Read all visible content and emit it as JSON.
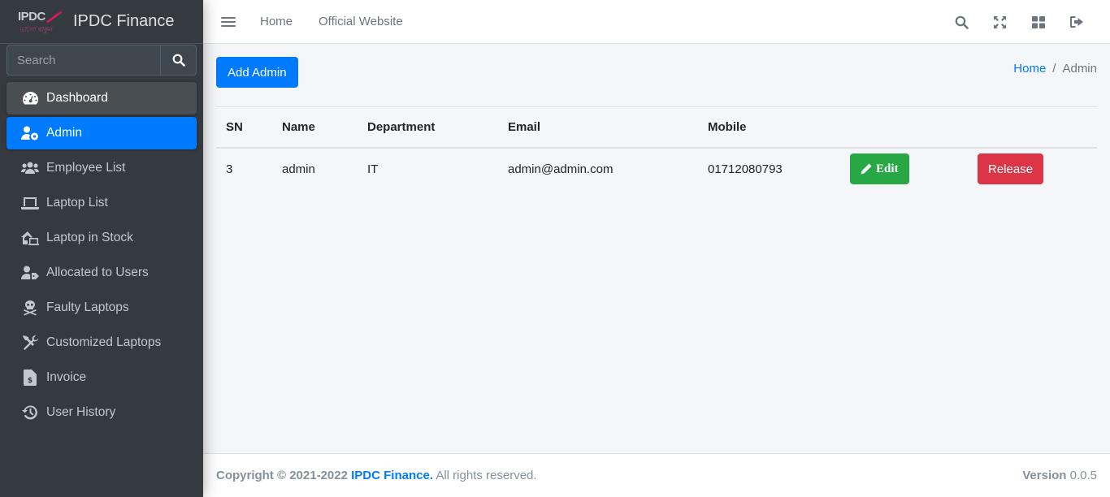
{
  "brand": {
    "name": "IPDC Finance",
    "logo_text": "IPDC",
    "logo_sub": "ভালো থাকুন"
  },
  "search": {
    "placeholder": "Search"
  },
  "sidebar": {
    "items": [
      {
        "label": "Dashboard",
        "icon": "tachometer-icon"
      },
      {
        "label": "Admin",
        "icon": "user-cog-icon"
      },
      {
        "label": "Employee List",
        "icon": "users-icon"
      },
      {
        "label": "Laptop List",
        "icon": "laptop-icon"
      },
      {
        "label": "Laptop in Stock",
        "icon": "laptop-house-icon"
      },
      {
        "label": "Allocated to Users",
        "icon": "user-tag-icon"
      },
      {
        "label": "Faulty Laptops",
        "icon": "skull-crossbones-icon"
      },
      {
        "label": "Customized Laptops",
        "icon": "tools-icon"
      },
      {
        "label": "Invoice",
        "icon": "file-invoice-icon"
      },
      {
        "label": "User History",
        "icon": "history-icon"
      }
    ]
  },
  "topbar": {
    "links": [
      "Home",
      "Official Website"
    ],
    "icons": [
      "search-icon",
      "expand-icon",
      "th-large-icon",
      "sign-out-icon"
    ]
  },
  "content": {
    "add_button": "Add Admin",
    "breadcrumb": {
      "home": "Home",
      "separator": "/",
      "current": "Admin"
    },
    "table": {
      "headers": [
        "SN",
        "Name",
        "Department",
        "Email",
        "Mobile"
      ],
      "rows": [
        {
          "sn": "3",
          "name": "admin",
          "department": "IT",
          "email": "admin@admin.com",
          "mobile": "01712080793",
          "edit_label": "Edit",
          "release_label": "Release"
        }
      ]
    }
  },
  "footer": {
    "copyright_prefix": "Copyright © 2021-2022",
    "brand": "IPDC Finance.",
    "rights": "All rights reserved.",
    "version_label": "Version",
    "version_value": "0.0.5"
  },
  "colors": {
    "sidebar_bg": "#343a40",
    "primary": "#007bff",
    "success": "#28a745",
    "danger": "#dc3545",
    "brand_pink": "#c2185b"
  }
}
